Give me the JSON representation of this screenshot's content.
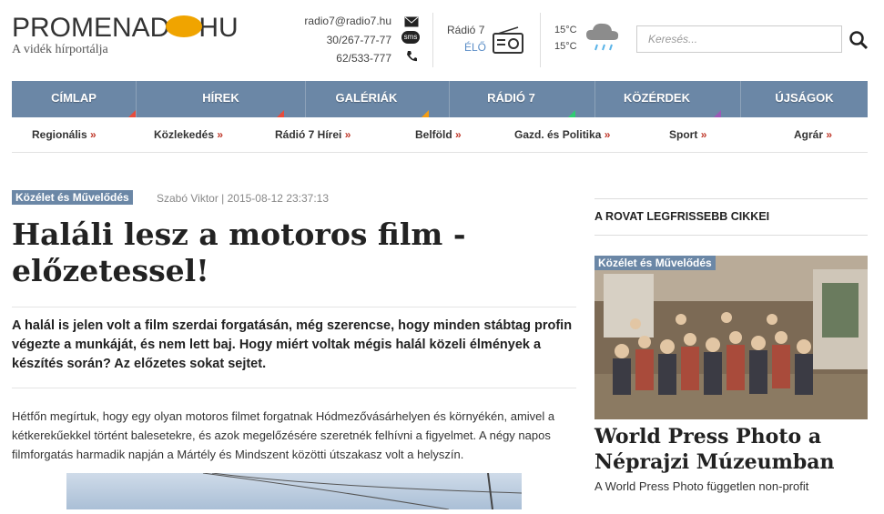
{
  "header": {
    "logo_left": "PROMENAD",
    "logo_right": "HU",
    "tagline": "A vidék hírportálja",
    "email": "radio7@radio7.hu",
    "phone_sms": "30/267-77-77",
    "phone": "62/533-777",
    "sms_label": "sms",
    "radio_label": "Rádió 7",
    "radio_live": "ÉLŐ",
    "temp_high": "15°C",
    "temp_low": "15°C",
    "search_placeholder": "Keresés..."
  },
  "nav": {
    "items": [
      {
        "label": "CÍMLAP",
        "color": "#e74c3c"
      },
      {
        "label": "HÍREK",
        "color": "#e74c3c"
      },
      {
        "label": "GALÉRIÁK",
        "color": "#f39c12"
      },
      {
        "label": "RÁDIÓ 7",
        "color": "#2ecc71"
      },
      {
        "label": "KÖZÉRDEK",
        "color": "#9b59b6"
      },
      {
        "label": "ÚJSÁGOK",
        "color": "#6b87a6"
      }
    ],
    "sub": [
      "Regionális",
      "Közlekedés",
      "Rádió 7 Hírei",
      "Belföld",
      "Gazd. és Politika",
      "Sport",
      "Agrár"
    ],
    "arrow": "»"
  },
  "article": {
    "category": "Közélet és Művelődés",
    "byline": "Szabó Viktor | 2015-08-12 23:37:13",
    "title": "Haláli lesz a motoros film - előzetessel!",
    "lead": "A halál is jelen volt a film szerdai forgatásán, még szerencse, hogy minden stábtag profin végezte a munkáját, és nem lett baj. Hogy miért voltak mégis halál közeli élmények a készítés során? Az előzetes sokat sejtet.",
    "body": "Hétfőn megírtuk, hogy egy olyan motoros filmet forgatnak Hódmezővásárhelyen és környékén, amivel a kétkerekűekkel történt balesetekre, és azok megelőzésére szeretnék felhívni a figyelmet. A négy napos filmforgatás harmadik napján a Mártély és Mindszent közötti útszakasz volt a helyszín."
  },
  "sidebar": {
    "title": "A ROVAT LEGFRISSEBB CIKKEI",
    "category": "Közélet és Művelődés",
    "headline": "World Press Photo a Néprajzi Múzeumban",
    "teaser": "A World Press Photo független non-profit"
  }
}
